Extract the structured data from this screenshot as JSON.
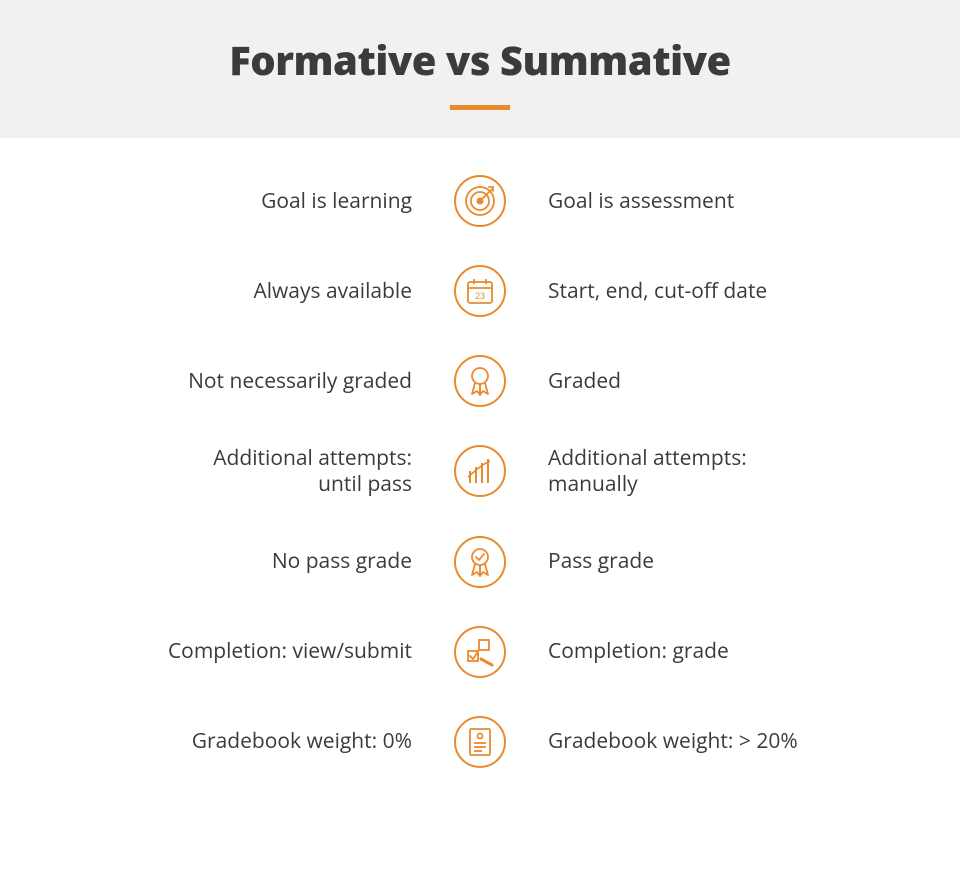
{
  "title": "Formative vs Summative",
  "accent": "#ea8a2f",
  "rows": [
    {
      "left": "Goal is learning",
      "right": "Goal is assessment",
      "icon": "target"
    },
    {
      "left": "Always available",
      "right": "Start, end, cut-off date",
      "icon": "calendar"
    },
    {
      "left": "Not necessarily graded",
      "right": "Graded",
      "icon": "ribbon"
    },
    {
      "left": "Additional attempts:\nuntil pass",
      "right": "Additional attempts:\nmanually",
      "icon": "chart"
    },
    {
      "left": "No pass grade",
      "right": "Pass grade",
      "icon": "ribbon-check"
    },
    {
      "left": "Completion: view/submit",
      "right": "Completion: grade",
      "icon": "checklist"
    },
    {
      "left": "Gradebook weight: 0%",
      "right": "Gradebook weight: > 20%",
      "icon": "certificate"
    }
  ]
}
